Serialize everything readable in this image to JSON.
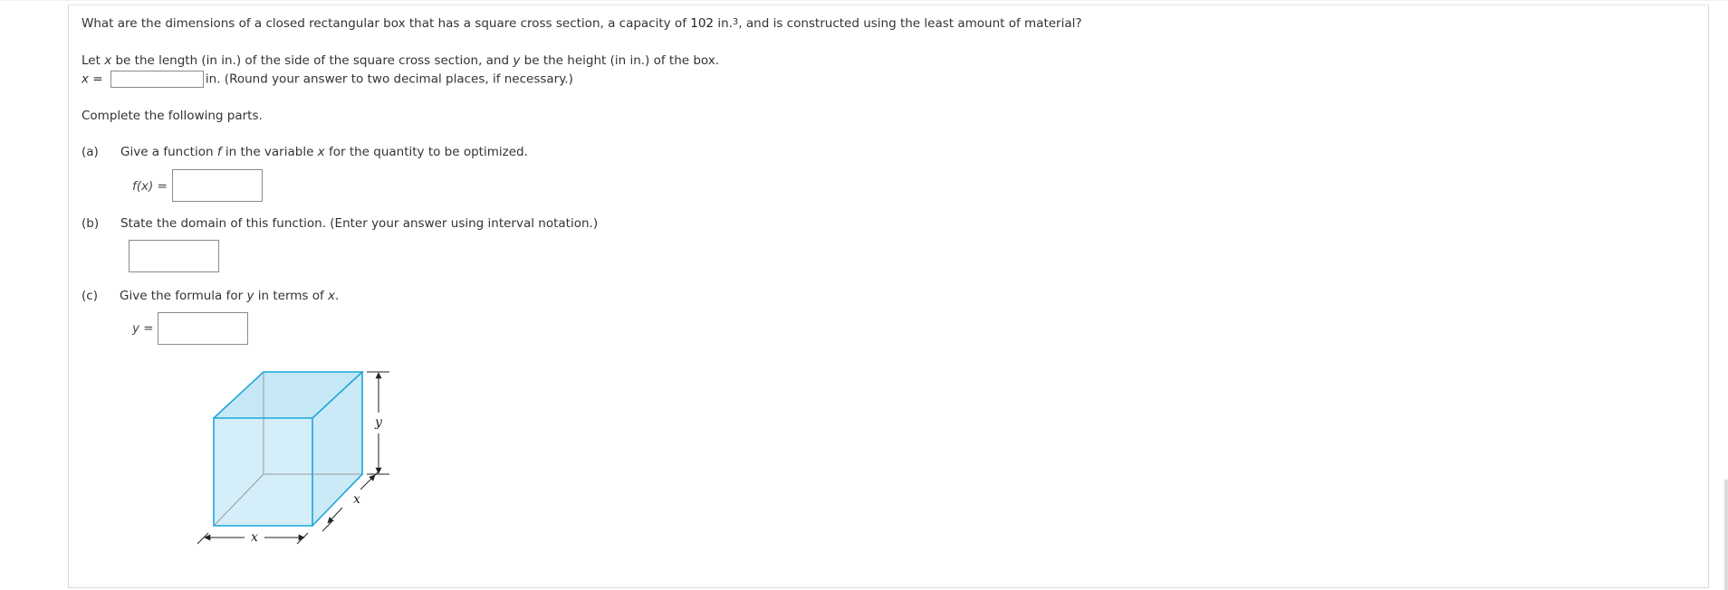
{
  "question": {
    "text_before": "What are the dimensions of a closed rectangular box that has a square cross section, a capacity of ",
    "capacity": "102",
    "unit": "in.",
    "unit_exp": "3",
    "text_after": ", and is constructed using the least amount of material?"
  },
  "setup": {
    "let_t1": "Let ",
    "let_x": "x",
    "let_t2": " be the length (in in.) of the side of the square cross section, and ",
    "let_y": "y",
    "let_t3": " be the height (in in.) of the box.",
    "x_label": "x",
    "eq": " = ",
    "x_suffix": "in. (Round your answer to two decimal places, if necessary.)"
  },
  "complete_text": "Complete the following parts.",
  "parts": {
    "a": {
      "label": "(a)",
      "t1": "Give a function ",
      "f": "f",
      "t2": " in the variable ",
      "x": "x",
      "t3": " for the quantity to be optimized.",
      "answer_label": "f(x) ="
    },
    "b": {
      "label": "(b)",
      "text": "State the domain of this function. (Enter your answer using interval notation.)"
    },
    "c": {
      "label": "(c)",
      "t1": "Give the formula for ",
      "y": "y",
      "t2": " in terms of ",
      "x": "x",
      "t3": ".",
      "answer_label": "y ="
    }
  },
  "figure": {
    "height_label": "y",
    "depth_label": "x",
    "width_label": "x",
    "colors": {
      "edge": "#1aa7d8",
      "fill": "#d4eefa",
      "hidden": "#9a9a9a",
      "dim": "#222222"
    }
  }
}
